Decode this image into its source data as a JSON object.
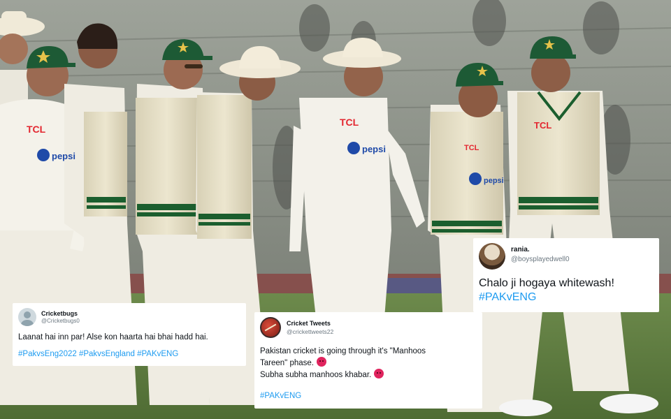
{
  "tweets": [
    {
      "id": "cricketbugs",
      "name": "Cricketbugs",
      "handle": "@Cricketbugs0",
      "text": "Laanat hai inn par! Alse kon haarta hai bhai hadd hai.",
      "tags": "#PakvsEng2022 #PakvsEngland #PAKvENG"
    },
    {
      "id": "cricket-tweets",
      "name": "Cricket Tweets",
      "handle": "@crickettweets22",
      "line1": "Pakistan cricket is going through it's \"Manhoos",
      "line2": "Tareen\" phase.",
      "line3": "Subha subha manhoos khabar.",
      "tags": "#PAKvENG"
    },
    {
      "id": "rania",
      "name": "rania.",
      "handle": "@boysplayedwell0",
      "text": "Chalo ji hogaya whitewash!",
      "tags": "#PAKvENG"
    }
  ],
  "players": [
    {
      "chest": "TCL",
      "sponsor": "pepsi"
    },
    {
      "chest": "TCL",
      "sponsor": "pepsi"
    },
    {
      "chest": "TCL",
      "sponsor": "pepsi"
    },
    {
      "chest": "TCL",
      "sponsor": "pepsi"
    }
  ],
  "colors": {
    "pitch": "#5f7b40",
    "stands": "#8d9189",
    "sweater": "#e3dcc3",
    "trim": "#1b5e2e",
    "cap": "#1d5a35",
    "hashtag": "#1d9bf0",
    "sponsor_red": "#e3262f"
  }
}
